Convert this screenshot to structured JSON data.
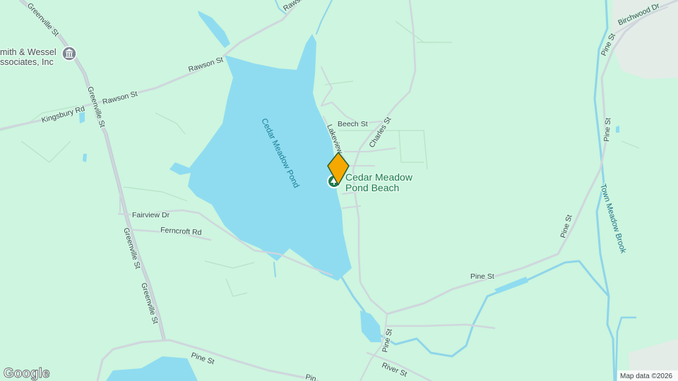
{
  "map": {
    "colors": {
      "land": "#cdf5df",
      "water": "#8fdcf0",
      "road": "#cfd6dd",
      "marker": "#f5a800",
      "poi_green": "#1e7a4f"
    },
    "water_labels": {
      "pond": "Cedar Meadow Pond",
      "brook": "Town Meadow Brook"
    },
    "road_labels": {
      "greenville_1": "Greenville St",
      "greenville_2": "Greenville St",
      "greenville_3": "Greenville St",
      "greenville_4": "Greenville St",
      "rawson_1": "Rawson St",
      "rawson_2": "Rawson St",
      "rawson_3": "Rawso",
      "kingsbury": "Kingsbury Rd",
      "fairview": "Fairview Dr",
      "ferncroft": "Ferncroft Rd",
      "beech": "Beech St",
      "charles": "Charles St",
      "lakeview": "Lakeview",
      "pine_1": "Pine St",
      "pine_2": "Pine St",
      "pine_3": "Pine St",
      "pine_4": "Pine St",
      "pine_5": "Pine St",
      "pine_6": "Pine St",
      "pine_7": "Pin",
      "birchwood": "Birchwood Dr",
      "river": "River St"
    },
    "places": {
      "beach_line1": "Cedar Meadow",
      "beach_line2": "Pond Beach",
      "beach_icon": "park-pin-icon"
    },
    "pois": {
      "company_line1": "mith & Wessel",
      "company_line2": "ssociates, Inc",
      "company_icon": "building-icon"
    },
    "marker_icon": "location-marker-icon",
    "logo": "Google",
    "attribution": "Map data ©2026"
  }
}
